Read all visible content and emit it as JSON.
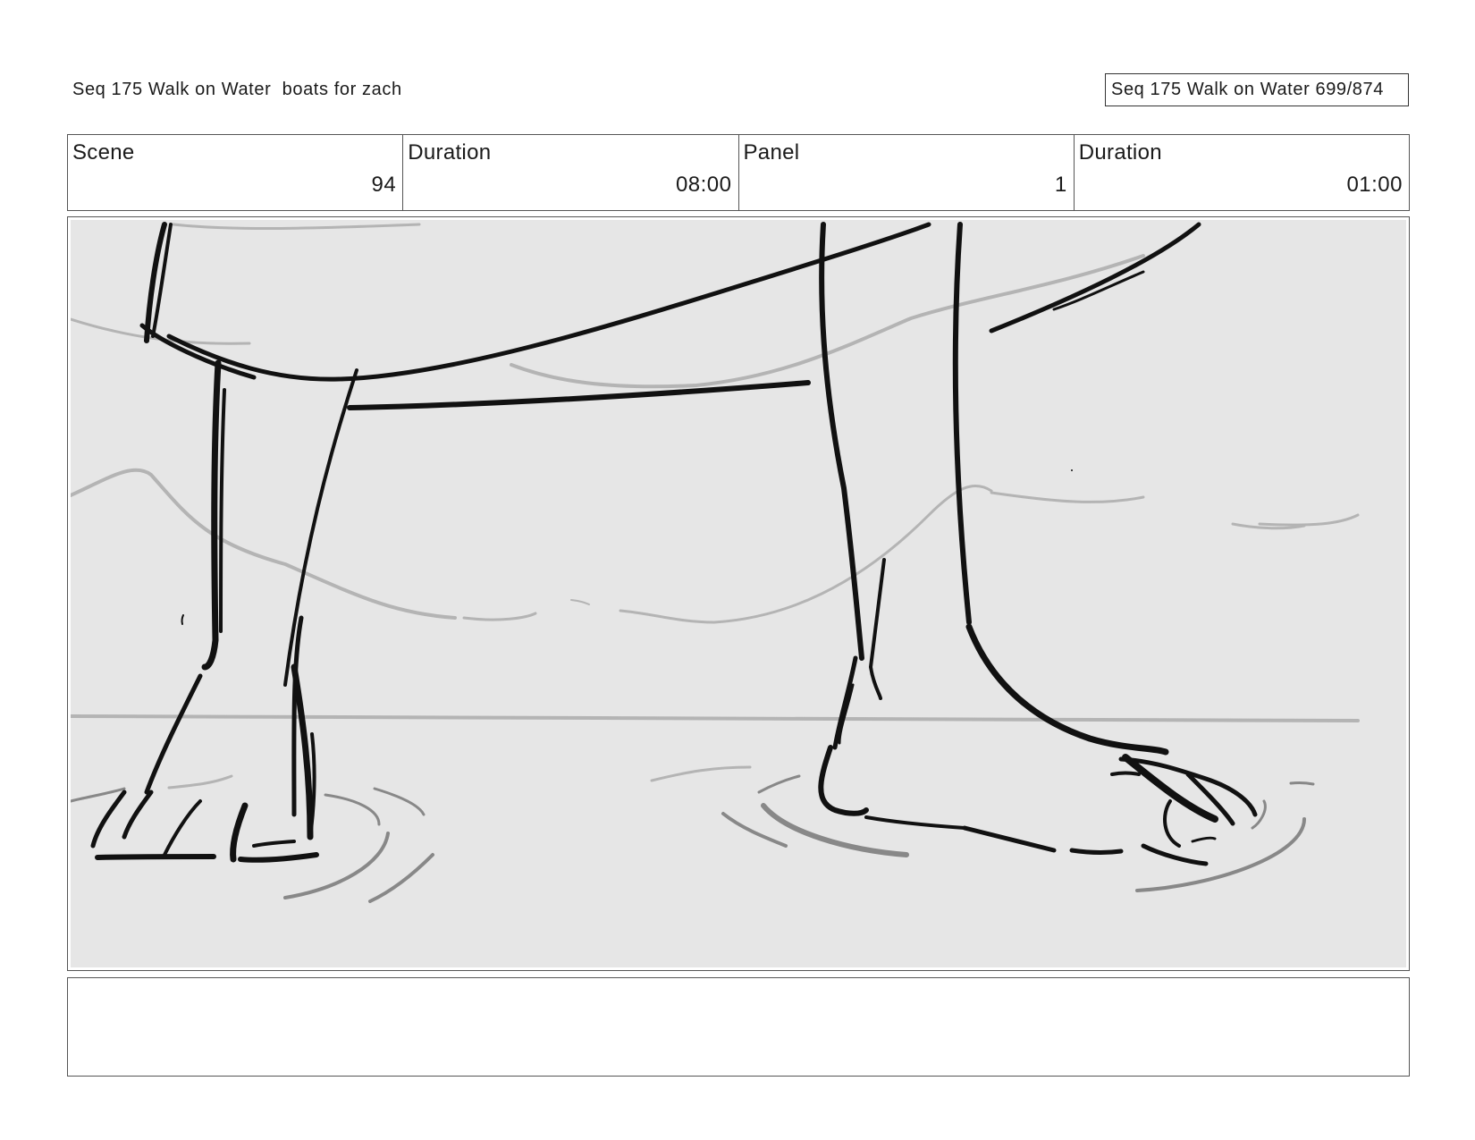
{
  "header": {
    "title": "Seq 175 Walk on Water  boats for zach",
    "page_ref": "Seq 175 Walk on Water 699/874"
  },
  "info": {
    "scene_label": "Scene",
    "scene_value": "94",
    "scene_duration_label": "Duration",
    "scene_duration_value": "08:00",
    "panel_label": "Panel",
    "panel_value": "1",
    "panel_duration_label": "Duration",
    "panel_duration_value": "01:00"
  },
  "panel": {
    "image": "sketch of two legs and bare feet walking on water with ripples",
    "background_color": "#e6e6e6",
    "ink_color": "#111111",
    "secondary_ink_color": "#b4b4b4"
  },
  "notes": {
    "text": ""
  }
}
